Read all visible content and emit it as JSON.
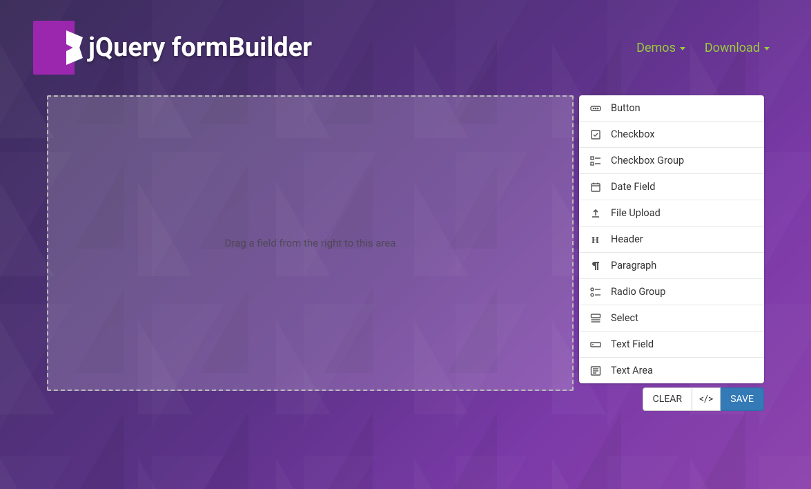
{
  "header": {
    "brand_title": "jQuery formBuilder",
    "nav": [
      {
        "label": "Demos",
        "has_dropdown": true
      },
      {
        "label": "Download",
        "has_dropdown": true
      }
    ]
  },
  "stage": {
    "placeholder": "Drag a field from the right to this area"
  },
  "controls": [
    {
      "icon": "button-icon",
      "label": "Button"
    },
    {
      "icon": "checkbox-icon",
      "label": "Checkbox"
    },
    {
      "icon": "checkbox-group-icon",
      "label": "Checkbox Group"
    },
    {
      "icon": "date-icon",
      "label": "Date Field"
    },
    {
      "icon": "file-upload-icon",
      "label": "File Upload"
    },
    {
      "icon": "header-icon",
      "label": "Header"
    },
    {
      "icon": "paragraph-icon",
      "label": "Paragraph"
    },
    {
      "icon": "radio-group-icon",
      "label": "Radio Group"
    },
    {
      "icon": "select-icon",
      "label": "Select"
    },
    {
      "icon": "text-field-icon",
      "label": "Text Field"
    },
    {
      "icon": "textarea-icon",
      "label": "Text Area"
    }
  ],
  "actions": {
    "clear": "CLEAR",
    "code_toggle": "</>",
    "save": "SAVE"
  },
  "colors": {
    "accent": "#9ccc3c",
    "primary": "#337ab7",
    "logo": "#9b27af"
  }
}
